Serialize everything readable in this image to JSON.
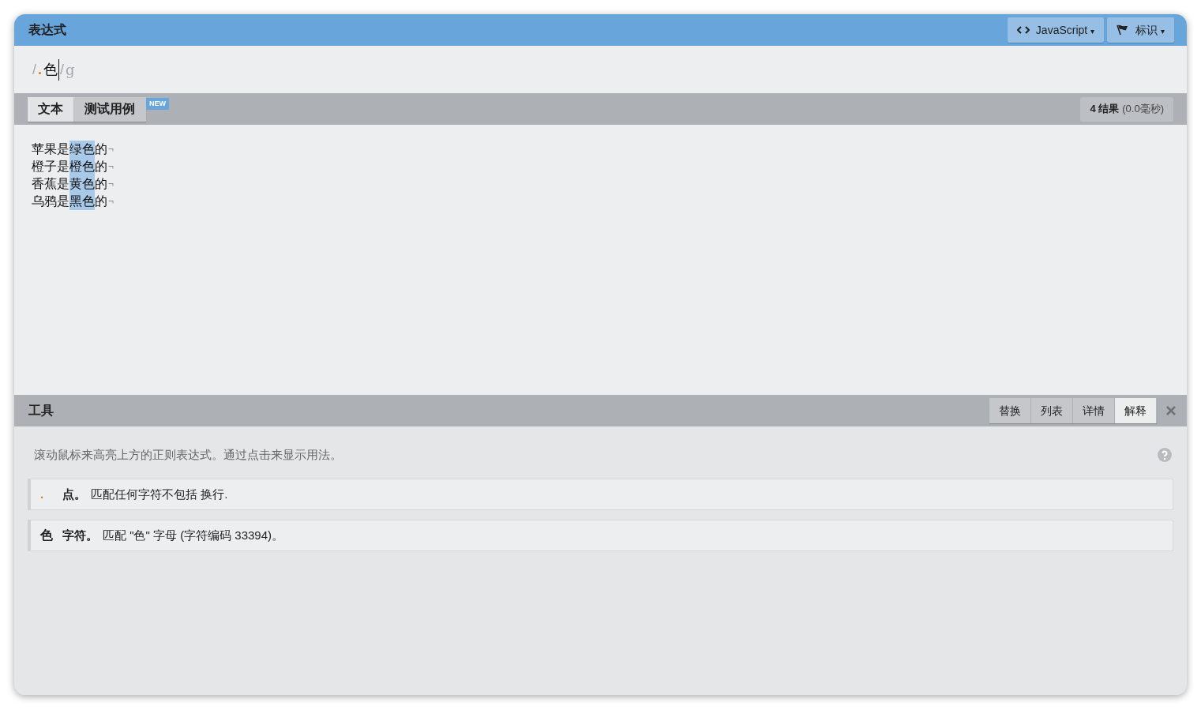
{
  "header": {
    "title": "表达式",
    "buttons": [
      {
        "kind": "code",
        "label": "JavaScript",
        "caret": "▾"
      },
      {
        "kind": "flag",
        "label": "标识",
        "caret": "▾"
      }
    ]
  },
  "expression": {
    "tokens": [
      {
        "kind": "delimiter",
        "text": "/"
      },
      {
        "kind": "dot",
        "text": "."
      },
      {
        "kind": "char",
        "text": "色"
      },
      {
        "kind": "delimiter",
        "text": "/"
      },
      {
        "kind": "flags",
        "text": "g"
      }
    ]
  },
  "text_tabs": [
    {
      "label": "文本",
      "selected": true
    },
    {
      "label": "测试用例",
      "selected": false,
      "badge": "NEW"
    }
  ],
  "result": {
    "count": "4 结果",
    "time": "(0.0毫秒)"
  },
  "text_lines": [
    {
      "before": "苹果是",
      "match": "绿色",
      "after": "的",
      "eol": "¬"
    },
    {
      "before": "橙子是",
      "match": "橙色",
      "after": "的",
      "eol": "¬"
    },
    {
      "before": "香蕉是",
      "match": "黄色",
      "after": "的",
      "eol": "¬"
    },
    {
      "before": "乌鸦是",
      "match": "黑色",
      "after": "的",
      "eol": "¬"
    }
  ],
  "tools": {
    "title": "工具",
    "tabs": [
      {
        "label": "替换",
        "selected": false
      },
      {
        "label": "列表",
        "selected": false
      },
      {
        "label": "详情",
        "selected": false
      },
      {
        "label": "解释",
        "selected": true
      }
    ],
    "hint": "滚动鼠标来高亮上方的正则表达式。通过点击来显示用法。",
    "items": [
      {
        "kind": "dot",
        "token": ".",
        "name": "点。",
        "description": "匹配任何字符不包括 换行."
      },
      {
        "kind": "char",
        "token": "色",
        "name": "字符。",
        "description": "匹配 \"色\" 字母 (字符编码 33394)。"
      }
    ]
  }
}
